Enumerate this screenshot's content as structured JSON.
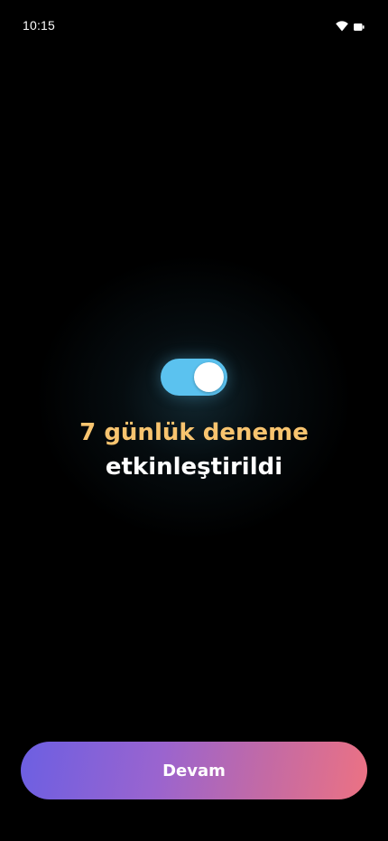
{
  "status_bar": {
    "time": "10:15",
    "icons": [
      "wifi-icon",
      "battery-icon"
    ]
  },
  "toggle": {
    "state": "on",
    "color": "#5bc2ef"
  },
  "headline": {
    "line1": "7 günlük deneme",
    "line2": "etkinleştirildi",
    "line1_color": "#f8c46f"
  },
  "actions": {
    "continue_label": "Devam",
    "gradient_start": "#6c5fe2",
    "gradient_end": "#ec7283"
  }
}
